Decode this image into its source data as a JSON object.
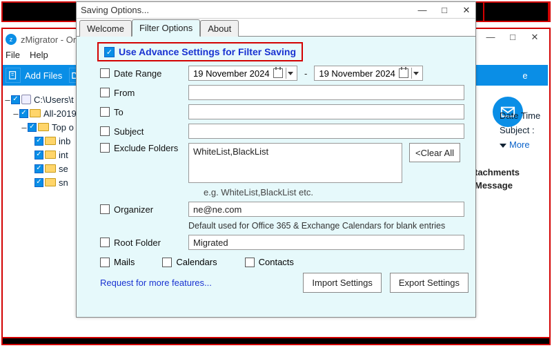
{
  "bgWindow": {
    "title": "zMigrator - On-",
    "menu": {
      "file": "File",
      "help": "Help"
    },
    "toolbar": {
      "addFiles": "Add Files",
      "rightItem": "e"
    },
    "winControls": {
      "min": "—",
      "max": "□",
      "close": "✕"
    }
  },
  "tree": {
    "root": "C:\\Users\\t",
    "n1": "All-2019",
    "n2": "Top o",
    "leaves": [
      "inb",
      "int",
      "se",
      "sn"
    ]
  },
  "rightPanel": {
    "dateTime": "Date Time",
    "subject": "Subject :",
    "more": "More",
    "attachments": "tachments",
    "message": "Message"
  },
  "dialog": {
    "title": "Saving Options...",
    "winControls": {
      "min": "—",
      "max": "□",
      "close": "✕"
    },
    "tabs": {
      "welcome": "Welcome",
      "filter": "Filter Options",
      "about": "About"
    },
    "advLabel": "Use Advance Settings for Filter Saving",
    "rows": {
      "dateRange": "Date Range",
      "from": "From",
      "to": "To",
      "subject": "Subject",
      "excludeFolders": "Exclude Folders",
      "organizer": "Organizer",
      "rootFolder": "Root Folder"
    },
    "values": {
      "dateStart": "19 November 2024",
      "dateEnd": "19 November 2024",
      "from": "",
      "to": "",
      "subject": "",
      "excludeFolders": "WhiteList,BlackList",
      "organizer": "ne@ne.com",
      "rootFolder": "Migrated"
    },
    "clearAll": "<Clear All",
    "exHint": "e.g. WhiteList,BlackList etc.",
    "orgHint": "Default used for Office 365 & Exchange Calendars for blank entries",
    "cats": {
      "mails": "Mails",
      "calendars": "Calendars",
      "contacts": "Contacts"
    },
    "requestLink": "Request for more features...",
    "importBtn": "Import Settings",
    "exportBtn": "Export Settings",
    "dash": "-"
  }
}
